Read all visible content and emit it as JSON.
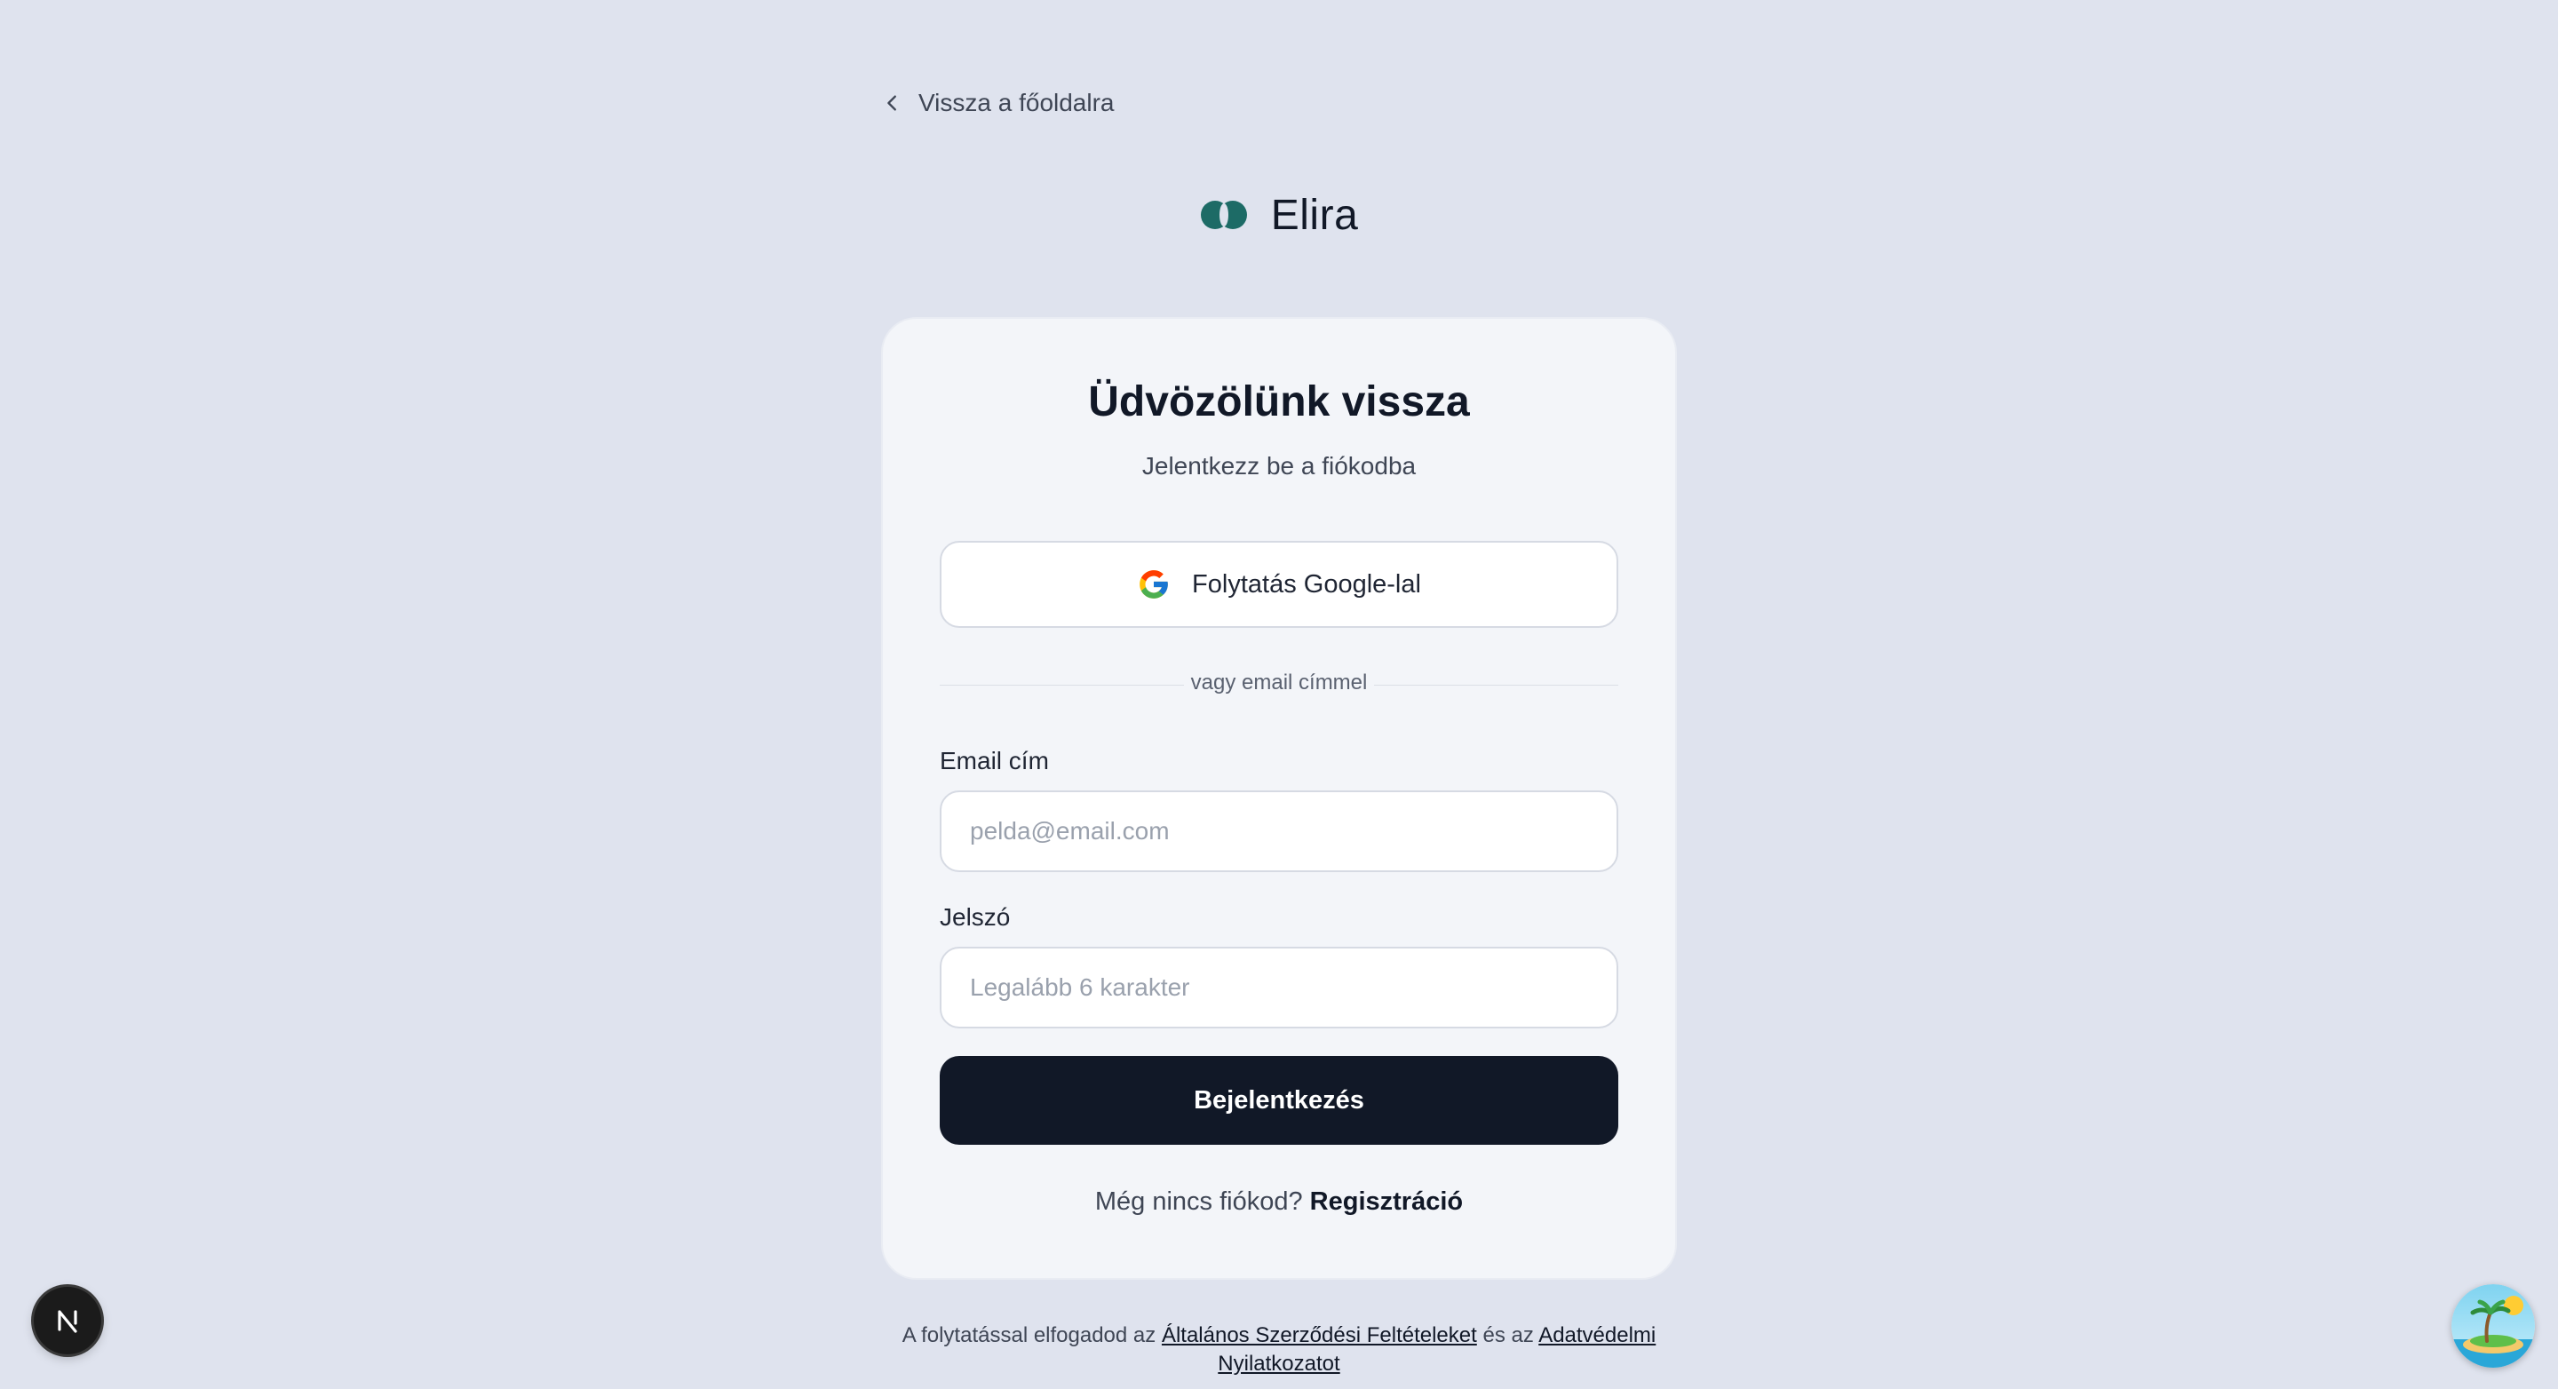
{
  "nav": {
    "back_label": "Vissza a főoldalra"
  },
  "brand": {
    "name": "Elira",
    "logo_color": "#1d6b66"
  },
  "card": {
    "title": "Üdvözölünk vissza",
    "subtitle": "Jelentkezz be a fiókodba",
    "google_button_label": "Folytatás Google-lal",
    "divider_text": "vagy email címmel",
    "email": {
      "label": "Email cím",
      "placeholder": "pelda@email.com",
      "value": ""
    },
    "password": {
      "label": "Jelszó",
      "placeholder": "Legalább 6 karakter",
      "value": ""
    },
    "submit_label": "Bejelentkezés",
    "signup_prompt": "Még nincs fiókod?",
    "signup_link": "Regisztráció"
  },
  "footer": {
    "prefix": "A folytatással elfogadod az",
    "terms_link": "Általános Szerződési Feltételeket",
    "middle": "és az",
    "privacy_link": "Adatvédelmi Nyilatkozatot"
  },
  "icons": {
    "back": "chevron-left-icon",
    "google": "google-icon",
    "nextjs": "nextjs-n-icon",
    "avatar": "island-avatar"
  },
  "colors": {
    "background": "#dfe3ee",
    "card": "#f3f5f9",
    "primary_button": "#111827",
    "text_muted": "#3f4655"
  }
}
